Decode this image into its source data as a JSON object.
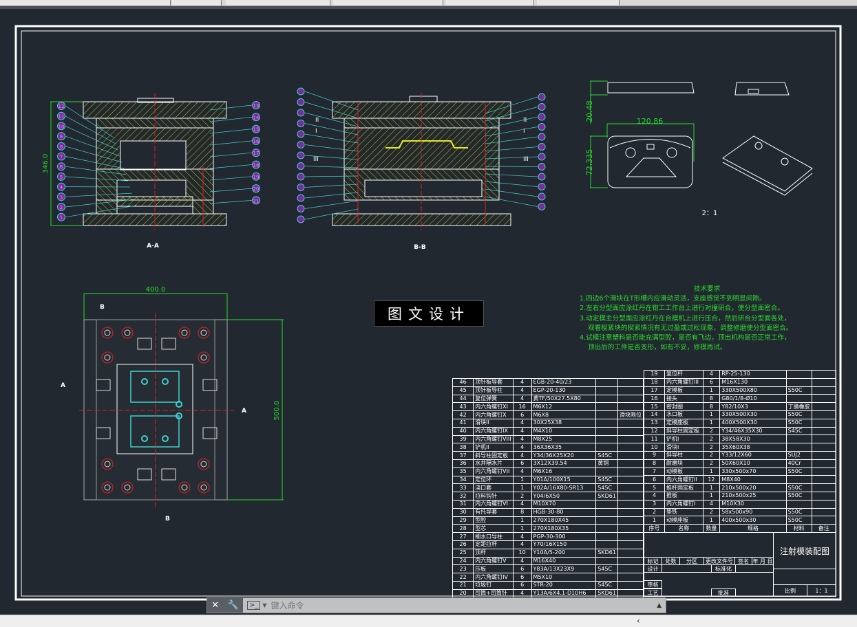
{
  "window": {
    "command_placeholder": "键入命令"
  },
  "drawing": {
    "section_aa_label": "A-A",
    "section_bb_label": "B-B",
    "dim_height_aa": "346.0",
    "dim_width_plan": "400.0",
    "dim_height_plan": "500.0",
    "dim_part_width": "120.86",
    "dim_part_height": "72.335",
    "dim_part_thickness": "20.48",
    "part_scale": "2：1",
    "cut_marks": {
      "a": "A",
      "b": "B"
    },
    "balloons_aa_left": [
      "12",
      "11",
      "10",
      "9",
      "8",
      "7",
      "6",
      "5",
      "4",
      "3",
      "2",
      "1"
    ],
    "balloons_aa_right": [
      "13",
      "14",
      "15",
      "16",
      "17",
      "18",
      "19",
      "20",
      "21"
    ],
    "bb_marks": [
      "II",
      "I",
      "III"
    ]
  },
  "brand": "图文设计",
  "tech_requirements": {
    "title": "技术要求",
    "lines": [
      "1.四边6个滑块在T形槽内应滑动灵活，支座感觉不到明显间隙。",
      "2.左右分型面应涂红丹在钳工工作台上进行对撞研合，使分型面密合。",
      "3.动定模主分型面应涂红丹在合模机上进行压合，然后研合分型面各处，",
      "观看楔紧块的楔紧情况有无过盈或过松现象，调整修磨使分型面密合。",
      "4.试模注意塑料是否能充满型腔，是否有飞边，顶出机构是否正常工作，",
      "顶出后的工件是否变形，如有不妥，修模再试。"
    ]
  },
  "bom_left": [
    [
      "46",
      "顶针板导套",
      "4",
      "EGB-20-40/23",
      "",
      ""
    ],
    [
      "45",
      "顶针板导柱",
      "4",
      "EGP-20-130",
      "",
      ""
    ],
    [
      "44",
      "复位弹簧",
      "4",
      "黄TF/50X27.5X80",
      "",
      ""
    ],
    [
      "43",
      "内六角螺钉XI",
      "16",
      "M6X12",
      "",
      ""
    ],
    [
      "42",
      "内六角螺钉X",
      "6",
      "M6X8",
      "",
      "滑块限位"
    ],
    [
      "41",
      "滑块II",
      "4",
      "30X25X38",
      "",
      ""
    ],
    [
      "40",
      "内六角螺钉IX",
      "4",
      "M4X10",
      "",
      ""
    ],
    [
      "39",
      "内六角螺钉VIII",
      "4",
      "M8X25",
      "",
      ""
    ],
    [
      "38",
      "铲机II",
      "4",
      "36X36X35",
      "",
      ""
    ],
    [
      "37",
      "斜导柱固定板",
      "4",
      "Y34/36X25X20",
      "S45C",
      ""
    ],
    [
      "36",
      "水井隔水片",
      "6",
      "3X12X39.54",
      "黄铜",
      ""
    ],
    [
      "35",
      "内六角螺钉VII",
      "4",
      "M6X16",
      "",
      ""
    ],
    [
      "34",
      "定位环",
      "1",
      "Y01A/100X15",
      "S45C",
      ""
    ],
    [
      "33",
      "浇口套",
      "1",
      "Y02A/16X80-SR13",
      "S45C",
      ""
    ],
    [
      "32",
      "拉料钩针",
      "2",
      "Y04/6X50",
      "SKD61",
      ""
    ],
    [
      "31",
      "内六角螺钉VI",
      "4",
      "M10X70",
      "",
      ""
    ],
    [
      "30",
      "有托导套",
      "8",
      "HGB-30-80",
      "",
      ""
    ],
    [
      "29",
      "型腔",
      "1",
      "270X180X45",
      "",
      ""
    ],
    [
      "28",
      "型芯",
      "1",
      "270X180X35",
      "",
      ""
    ],
    [
      "27",
      "细水口导柱",
      "4",
      "PGP-30-300",
      "",
      ""
    ],
    [
      "26",
      "定距拉杆",
      "4",
      "Y70/16X150",
      "",
      ""
    ],
    [
      "25",
      "顶杆",
      "10",
      "Y10A/5-200",
      "SKD61",
      ""
    ],
    [
      "24",
      "内六角螺钉V",
      "4",
      "M16X40",
      "",
      ""
    ],
    [
      "23",
      "压板",
      "6",
      "Y83A/13X23X9",
      "S45C",
      ""
    ],
    [
      "22",
      "内六角螺钉IV",
      "6",
      "M5X10",
      "",
      ""
    ],
    [
      "21",
      "垃圾钉",
      "6",
      "STR-20",
      "S45C",
      ""
    ],
    [
      "20",
      "司筒+司筒针",
      "4",
      "Y13A/6X4.1-D10H6",
      "SKD61",
      ""
    ]
  ],
  "bom_right": [
    [
      "19",
      "复位杆",
      "4",
      "RP-25-130",
      "",
      ""
    ],
    [
      "18",
      "内六角螺钉III",
      "6",
      "M16X130",
      "",
      ""
    ],
    [
      "17",
      "定模板",
      "1",
      "330X500X80",
      "S50C",
      ""
    ],
    [
      "16",
      "接头",
      "8",
      "G80/1/8-Ø10",
      "",
      ""
    ],
    [
      "15",
      "密封圈",
      "8",
      "Y82/10X3",
      "丁腈橡胶",
      ""
    ],
    [
      "14",
      "水口板",
      "1",
      "330X500X30",
      "S50C",
      ""
    ],
    [
      "13",
      "定模座板",
      "1",
      "400X500X30",
      "S50C",
      ""
    ],
    [
      "12",
      "斜导柱固定板",
      "2",
      "Y34/46X35X30",
      "S45C",
      ""
    ],
    [
      "11",
      "铲机I",
      "2",
      "38X58X30",
      "",
      ""
    ],
    [
      "10",
      "滑块I",
      "2",
      "35X60X38",
      "",
      ""
    ],
    [
      "9",
      "斜导柱",
      "2",
      "Y33/12X60",
      "SUJ2",
      ""
    ],
    [
      "8",
      "耐磨块",
      "2",
      "50X60X10",
      "40Cr",
      ""
    ],
    [
      "7",
      "动模板",
      "1",
      "330x500x70",
      "S50C",
      ""
    ],
    [
      "6",
      "内六角螺钉II",
      "12",
      "M8X40",
      "",
      ""
    ],
    [
      "5",
      "推杆固定板",
      "1",
      "210x500x20",
      "S50C",
      ""
    ],
    [
      "4",
      "推板",
      "1",
      "210x500x25",
      "S50C",
      ""
    ],
    [
      "3",
      "内六角螺钉I",
      "4",
      "M10X30",
      "",
      ""
    ],
    [
      "2",
      "垫铁",
      "2",
      "58x500x90",
      "S50C",
      ""
    ],
    [
      "1",
      "动模座板",
      "1",
      "400x500x30",
      "S50C",
      ""
    ]
  ],
  "bom_header": [
    "序号",
    "名称",
    "数量",
    "规格",
    "材料",
    "备注"
  ],
  "title_block": {
    "title": "注射模装配图",
    "mark": "标记",
    "count": "处数",
    "zone": "分区",
    "change_doc": "更改文件号",
    "sign": "签名",
    "date": "年 月 日",
    "design": "设计",
    "standard": "标准化",
    "review": "审核",
    "process": "工艺",
    "approve": "批准",
    "scale_label": "比例",
    "scale_value": "1：1"
  },
  "colors": {
    "background": "#212830",
    "hatch": "#c8c800",
    "balloon": "#c050e0",
    "leader": "#40d0d0",
    "dimension": "#2bdc2b",
    "centerline": "#e02020"
  }
}
